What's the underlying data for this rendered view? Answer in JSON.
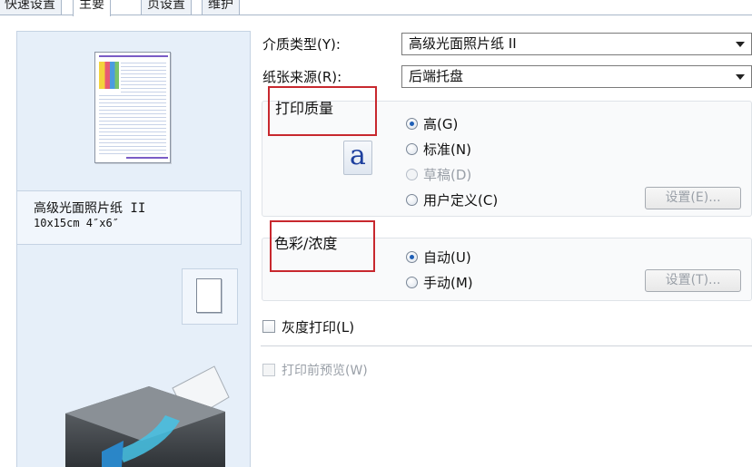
{
  "tabs": [
    "快速设置",
    "主要",
    "页设置",
    "维护"
  ],
  "preview": {
    "media_name": "高级光面照片纸 II",
    "media_size": "10x15cm 4″x6″"
  },
  "media_type": {
    "label": "介质类型(Y):",
    "value": "高级光面照片纸 II"
  },
  "paper_source": {
    "label": "纸张来源(R):",
    "value": "后端托盘"
  },
  "print_quality": {
    "title": "打印质量",
    "icon_glyph": "a",
    "options": [
      {
        "label": "高(G)",
        "selected": true,
        "enabled": true
      },
      {
        "label": "标准(N)",
        "selected": false,
        "enabled": true
      },
      {
        "label": "草稿(D)",
        "selected": false,
        "enabled": false
      },
      {
        "label": "用户定义(C)",
        "selected": false,
        "enabled": true
      }
    ],
    "settings_button": "设置(E)..."
  },
  "color_intensity": {
    "title": "色彩/浓度",
    "options": [
      {
        "label": "自动(U)",
        "selected": true,
        "enabled": true
      },
      {
        "label": "手动(M)",
        "selected": false,
        "enabled": true
      }
    ],
    "settings_button": "设置(T)..."
  },
  "grayscale": {
    "label": "灰度打印(L)",
    "checked": false
  },
  "preview_before_print": {
    "label": "打印前预览(W)",
    "checked": false,
    "enabled": false
  },
  "colors": {
    "highlight_border": "#c8282e",
    "panel_bg": "#e6eff9",
    "radio_dot": "#1f5fb6"
  }
}
